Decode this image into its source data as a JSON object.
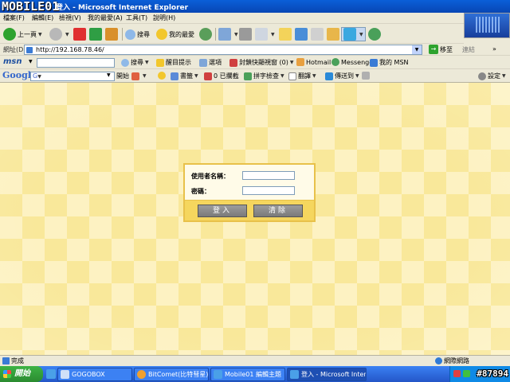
{
  "window": {
    "title": "登入 - Microsoft Internet Explorer"
  },
  "watermark_logo": "MOBILE01",
  "watermark_id": "#87894",
  "colors": {
    "titlebar": "#0846b4",
    "content_light": "#fdf2c2",
    "content_dark": "#f9e89a",
    "login_border": "#e8c14a",
    "taskbar": "#2456c8"
  },
  "menu": [
    "檔案(F)",
    "編輯(E)",
    "檢視(V)",
    "我的最愛(A)",
    "工具(T)",
    "說明(H)"
  ],
  "toolbar": {
    "back_label": "上一頁",
    "search_label": "搜尋",
    "favorites_label": "我的最愛"
  },
  "address": {
    "label": "網址(D)",
    "url": "http://192.168.78.46/",
    "go_label": "移至",
    "links_label": "連結"
  },
  "msn": {
    "logo": "msn",
    "search_label": "搜尋",
    "highlight_label": "醒目提示",
    "options_label": "選項",
    "popup_label": "封鎖快顯視窗 (0)",
    "hotmail_label": "Hotmail",
    "messenger_label": "Messenger",
    "mymsn_label": "我的 MSN"
  },
  "google": {
    "logo": "Google",
    "input_value": "G",
    "start_label": "開始",
    "bookmarks_label": "書籤",
    "blocked_label": "0 已攔截",
    "spell_label": "拼字檢查",
    "translate_label": "翻譯",
    "sendto_label": "傳送到",
    "settings_label": "設定"
  },
  "login": {
    "username_label": "使用者名稱：",
    "password_label": "密碼：",
    "login_button": "登入",
    "clear_button": "清除"
  },
  "status": {
    "text": "完成",
    "zone": "網際網路"
  },
  "taskbar": {
    "start_label": "開始",
    "tasks": [
      {
        "label": "GOGOBOX"
      },
      {
        "label": "BitComet(比特彗星) ..."
      },
      {
        "label": "Mobile01 編輯主題"
      },
      {
        "label": "登入 - Microsoft Inter..."
      }
    ]
  }
}
